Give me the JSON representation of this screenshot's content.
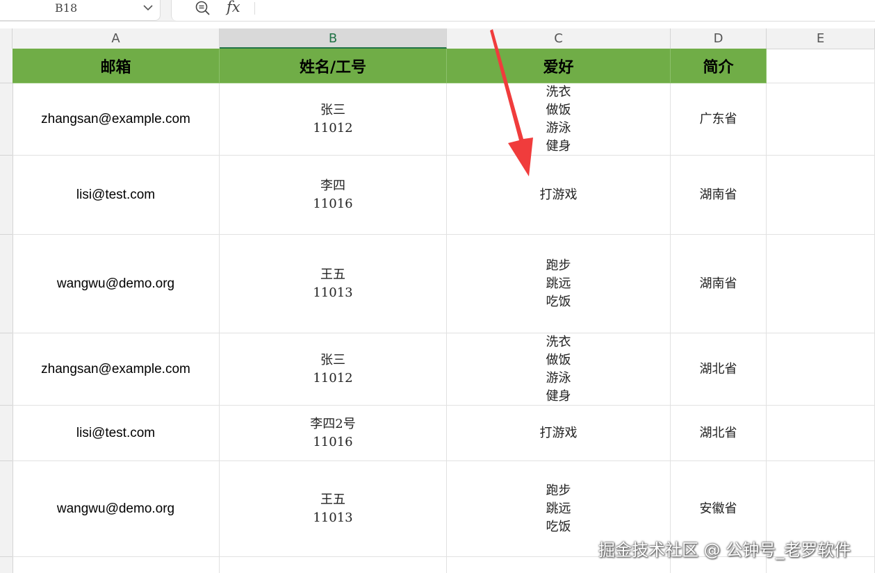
{
  "toolbar": {
    "cell_reference": "B18",
    "zoom_icon": "zoom-out-icon",
    "fx_label": "fx"
  },
  "columns": [
    "A",
    "B",
    "C",
    "D",
    "E"
  ],
  "active_column": "B",
  "table": {
    "header": [
      "邮箱",
      "姓名/工号",
      "爱好",
      "简介"
    ],
    "header_color": "#70ad47",
    "rows": [
      {
        "email": "zhangsan@example.com",
        "name": "张三",
        "id": "11012",
        "hobbies": [
          "洗衣",
          "做饭",
          "游泳",
          "健身"
        ],
        "intro": "广东省"
      },
      {
        "email": "lisi@test.com",
        "name": "李四",
        "id": "11016",
        "hobbies": [
          "打游戏"
        ],
        "intro": "湖南省"
      },
      {
        "email": "wangwu@demo.org",
        "name": "王五",
        "id": "11013",
        "hobbies": [
          "跑步",
          "跳远",
          "吃饭"
        ],
        "intro": "湖南省"
      },
      {
        "email": "zhangsan@example.com",
        "name": "张三",
        "id": "11012",
        "hobbies": [
          "洗衣",
          "做饭",
          "游泳",
          "健身"
        ],
        "intro": "湖北省"
      },
      {
        "email": "lisi@test.com",
        "name": "李四2号",
        "id": "11016",
        "hobbies": [
          "打游戏"
        ],
        "intro": "湖北省"
      },
      {
        "email": "wangwu@demo.org",
        "name": "王五",
        "id": "11013",
        "hobbies": [
          "跑步",
          "跳远",
          "吃饭"
        ],
        "intro": "安徽省"
      }
    ]
  },
  "annotation": {
    "arrow_color": "#f03c3c"
  },
  "watermark": "掘金技术社区 @ 公钟号_老罗软件"
}
